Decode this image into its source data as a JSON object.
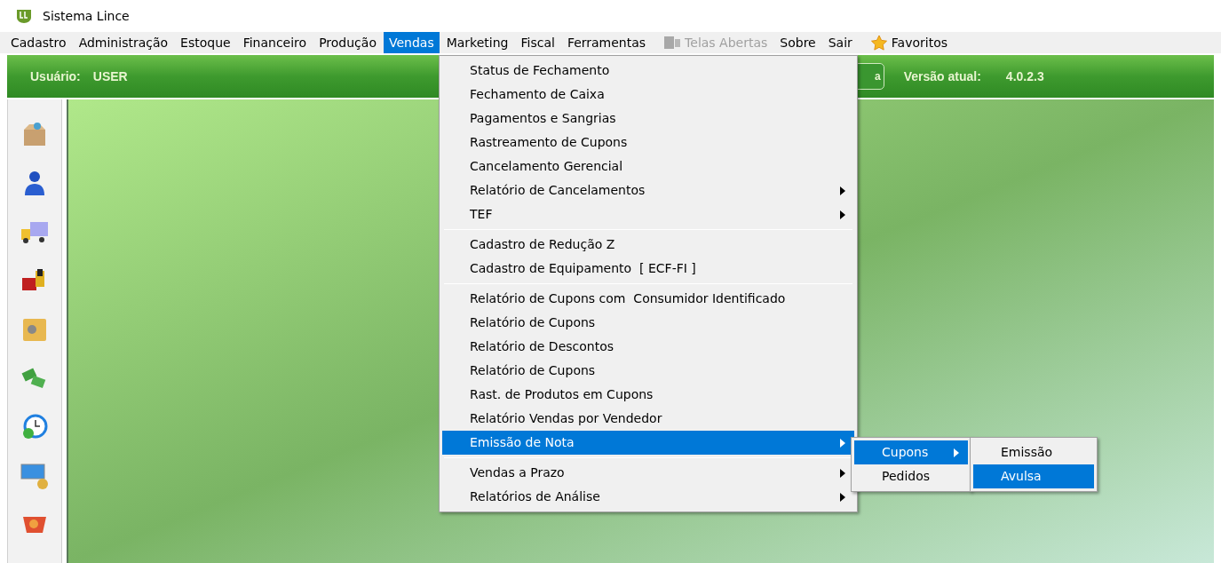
{
  "window": {
    "title": "Sistema Lince"
  },
  "menu_bar": [
    {
      "label": "Cadastro",
      "selected": false,
      "disabled": false,
      "kind": "text"
    },
    {
      "label": "Administração",
      "selected": false,
      "disabled": false,
      "kind": "text"
    },
    {
      "label": "Estoque",
      "selected": false,
      "disabled": false,
      "kind": "text"
    },
    {
      "label": "Financeiro",
      "selected": false,
      "disabled": false,
      "kind": "text"
    },
    {
      "label": "Produção",
      "selected": false,
      "disabled": false,
      "kind": "text"
    },
    {
      "label": "Vendas",
      "selected": true,
      "disabled": false,
      "kind": "text"
    },
    {
      "label": "Marketing",
      "selected": false,
      "disabled": false,
      "kind": "text"
    },
    {
      "label": "Fiscal",
      "selected": false,
      "disabled": false,
      "kind": "text"
    },
    {
      "label": "Ferramentas",
      "selected": false,
      "disabled": false,
      "kind": "text"
    },
    {
      "label": "Telas Abertas",
      "selected": false,
      "disabled": true,
      "kind": "windows"
    },
    {
      "label": "Sobre",
      "selected": false,
      "disabled": false,
      "kind": "text"
    },
    {
      "label": "Sair",
      "selected": false,
      "disabled": false,
      "kind": "text"
    },
    {
      "label": "Favoritos",
      "selected": false,
      "disabled": false,
      "kind": "star"
    }
  ],
  "info_bar": {
    "user_label": "Usuário:",
    "user": "USER",
    "hidden_button": "a",
    "version_label": "Versão atual:",
    "version": "4.0.2.3"
  },
  "dropdown": {
    "sections": [
      [
        {
          "label": "Status de Fechamento",
          "has_submenu": false,
          "selected": false
        },
        {
          "label": "Fechamento de Caixa",
          "has_submenu": false,
          "selected": false
        },
        {
          "label": "Pagamentos e Sangrias",
          "has_submenu": false,
          "selected": false
        },
        {
          "label": "Rastreamento de Cupons",
          "has_submenu": false,
          "selected": false
        },
        {
          "label": "Cancelamento Gerencial",
          "has_submenu": false,
          "selected": false
        },
        {
          "label": "Relatório de Cancelamentos",
          "has_submenu": true,
          "selected": false
        },
        {
          "label": "TEF",
          "has_submenu": true,
          "selected": false
        }
      ],
      [
        {
          "label": "Cadastro de Redução Z",
          "has_submenu": false,
          "selected": false
        },
        {
          "label": "Cadastro de Equipamento  [ ECF-FI ]",
          "has_submenu": false,
          "selected": false
        }
      ],
      [
        {
          "label": "Relatório de Cupons com  Consumidor Identificado",
          "has_submenu": false,
          "selected": false
        },
        {
          "label": "Relatório de Cupons",
          "has_submenu": false,
          "selected": false
        },
        {
          "label": "Relatório de Descontos",
          "has_submenu": false,
          "selected": false
        },
        {
          "label": "Relatório de Cupons",
          "has_submenu": false,
          "selected": false
        },
        {
          "label": "Rast. de Produtos em Cupons",
          "has_submenu": false,
          "selected": false
        },
        {
          "label": "Relatório Vendas por Vendedor",
          "has_submenu": false,
          "selected": false
        },
        {
          "label": "Emissão de Nota",
          "has_submenu": true,
          "selected": true
        }
      ],
      [
        {
          "label": "Vendas a Prazo",
          "has_submenu": true,
          "selected": false
        },
        {
          "label": "Relatórios de Análise",
          "has_submenu": true,
          "selected": false
        }
      ]
    ]
  },
  "submenu": [
    {
      "label": "Cupons",
      "has_submenu": true,
      "selected": true
    },
    {
      "label": "Pedidos",
      "has_submenu": false,
      "selected": false
    }
  ],
  "submenu_2": [
    {
      "label": "Emissão",
      "has_submenu": false,
      "selected": false
    },
    {
      "label": "Avulsa",
      "has_submenu": false,
      "selected": true
    }
  ]
}
